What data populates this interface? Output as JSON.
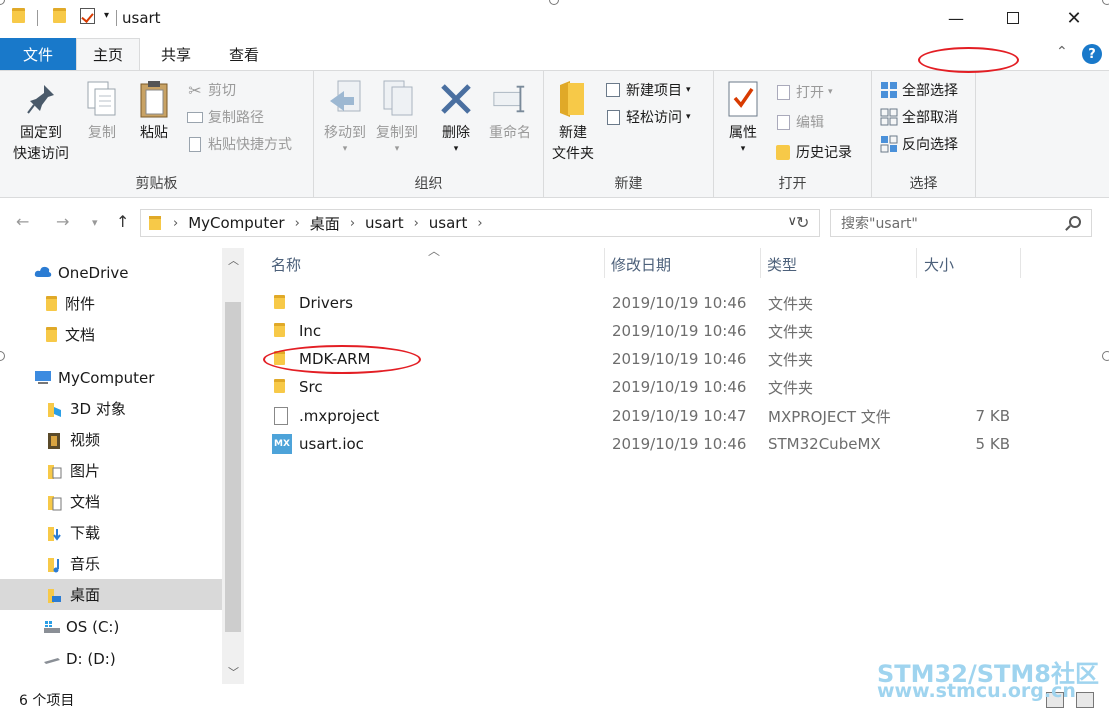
{
  "window": {
    "title": "usart"
  },
  "tabs": [
    "文件",
    "主页",
    "共享",
    "查看"
  ],
  "ribbon": {
    "clipboard": {
      "label": "剪贴板",
      "pin_line1": "固定到",
      "pin_line2": "快速访问",
      "copy": "复制",
      "paste": "粘贴",
      "cut": "剪切",
      "copy_path": "复制路径",
      "paste_shortcut": "粘贴快捷方式"
    },
    "organize": {
      "label": "组织",
      "move_to": "移动到",
      "copy_to": "复制到",
      "delete": "删除",
      "rename": "重命名"
    },
    "new": {
      "label": "新建",
      "new_folder_line1": "新建",
      "new_folder_line2": "文件夹",
      "new_item": "新建项目",
      "easy_access": "轻松访问"
    },
    "open": {
      "label": "打开",
      "properties": "属性",
      "open": "打开",
      "edit": "编辑",
      "history": "历史记录"
    },
    "select": {
      "label": "选择",
      "select_all": "全部选择",
      "select_none": "全部取消",
      "invert": "反向选择"
    }
  },
  "address": {
    "crumbs": [
      "MyComputer",
      "桌面",
      "usart",
      "usart"
    ],
    "search_placeholder": "搜索\"usart\""
  },
  "nav": {
    "items": [
      {
        "label": "OneDrive",
        "icon": "cloud-icon"
      },
      {
        "label": "附件",
        "icon": "folder-icon"
      },
      {
        "label": "文档",
        "icon": "folder-icon"
      },
      {
        "label": "MyComputer",
        "icon": "computer-icon"
      },
      {
        "label": "3D 对象",
        "icon": "3d-objects-icon"
      },
      {
        "label": "视频",
        "icon": "video-icon"
      },
      {
        "label": "图片",
        "icon": "pictures-icon"
      },
      {
        "label": "文档",
        "icon": "documents-icon"
      },
      {
        "label": "下载",
        "icon": "download-icon"
      },
      {
        "label": "音乐",
        "icon": "music-icon"
      },
      {
        "label": "桌面",
        "icon": "desktop-icon"
      },
      {
        "label": "OS (C:)",
        "icon": "drive-c-icon"
      },
      {
        "label": "D: (D:)",
        "icon": "drive-d-icon"
      }
    ]
  },
  "columns": {
    "name": "名称",
    "date": "修改日期",
    "type": "类型",
    "size": "大小"
  },
  "files": [
    {
      "name": "Drivers",
      "date": "2019/10/19 10:46",
      "type": "文件夹",
      "size": ""
    },
    {
      "name": "Inc",
      "date": "2019/10/19 10:46",
      "type": "文件夹",
      "size": ""
    },
    {
      "name": "MDK-ARM",
      "date": "2019/10/19 10:46",
      "type": "文件夹",
      "size": ""
    },
    {
      "name": "Src",
      "date": "2019/10/19 10:46",
      "type": "文件夹",
      "size": ""
    },
    {
      "name": ".mxproject",
      "date": "2019/10/19 10:47",
      "type": "MXPROJECT 文件",
      "size": "7 KB"
    },
    {
      "name": "usart.ioc",
      "date": "2019/10/19 10:46",
      "type": "STM32CubeMX",
      "size": "5 KB"
    }
  ],
  "status": {
    "count": "6 个项目"
  },
  "watermark": {
    "line1": "STM32/STM8社区",
    "line2": "www.stmcu.org.cn"
  },
  "colors": {
    "accent": "#1979ca",
    "annotation": "#e31e24",
    "watermark": "#9fd4ef"
  }
}
